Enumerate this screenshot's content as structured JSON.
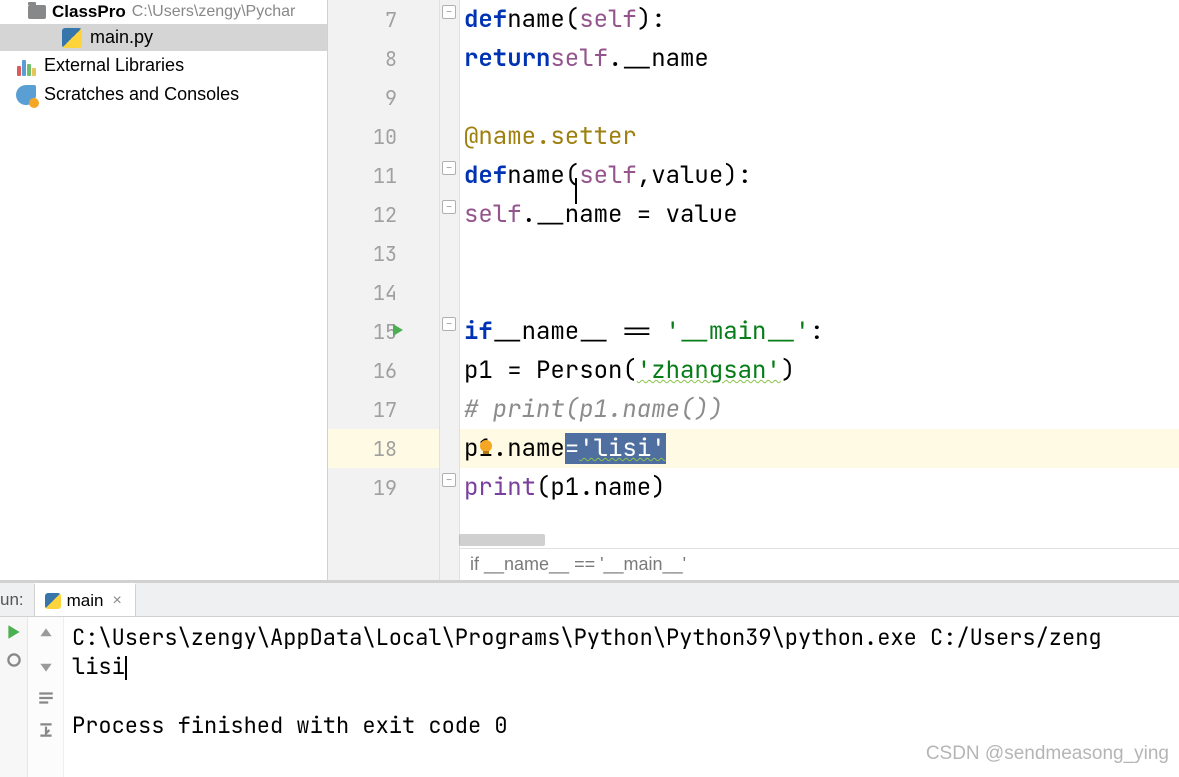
{
  "sidebar": {
    "project_name": "ClassPro",
    "project_path": "C:\\Users\\zengy\\Pychar",
    "file": "main.py",
    "external": "External Libraries",
    "scratches": "Scratches and Consoles"
  },
  "gutter": {
    "lines": [
      "7",
      "8",
      "9",
      "10",
      "11",
      "12",
      "13",
      "14",
      "15",
      "16",
      "17",
      "18",
      "19"
    ],
    "highlight_line": 18,
    "run_icon_line": 15,
    "bulb_line": 18
  },
  "code": {
    "l7": {
      "kw": "def",
      "fn": "name",
      "self": "self",
      "tail": "):"
    },
    "l8": {
      "kw": "return",
      "self": "self",
      "attr": ".__name"
    },
    "l10": {
      "dec": "@name.setter"
    },
    "l11": {
      "kw": "def",
      "fn": "name",
      "self": "self",
      "args": ",value):"
    },
    "l12": {
      "self": "self",
      "rest": ".__name = value"
    },
    "l15": {
      "kw": "if",
      "dunder": "__name__",
      "eq": " == ",
      "str": "'__main__'",
      "colon": ":"
    },
    "l16": {
      "lhs": "p1 = Person(",
      "str": "'zhangsan'",
      "rhs": ")"
    },
    "l17": {
      "com": "# print(p1.name())"
    },
    "l18": {
      "lhs": "p1.name",
      "eq": "=",
      "str": "'lisi'"
    },
    "l19": {
      "fn": "print",
      "args": "(p1.name)"
    }
  },
  "breadcrumb": "if __name__ == '__main__'",
  "run": {
    "label": "un:",
    "tab": "main",
    "cmd": "C:\\Users\\zengy\\AppData\\Local\\Programs\\Python\\Python39\\python.exe C:/Users/zeng",
    "output": "lisi",
    "exit": "Process finished with exit code 0"
  },
  "watermark": "CSDN @sendmeasong_ying"
}
